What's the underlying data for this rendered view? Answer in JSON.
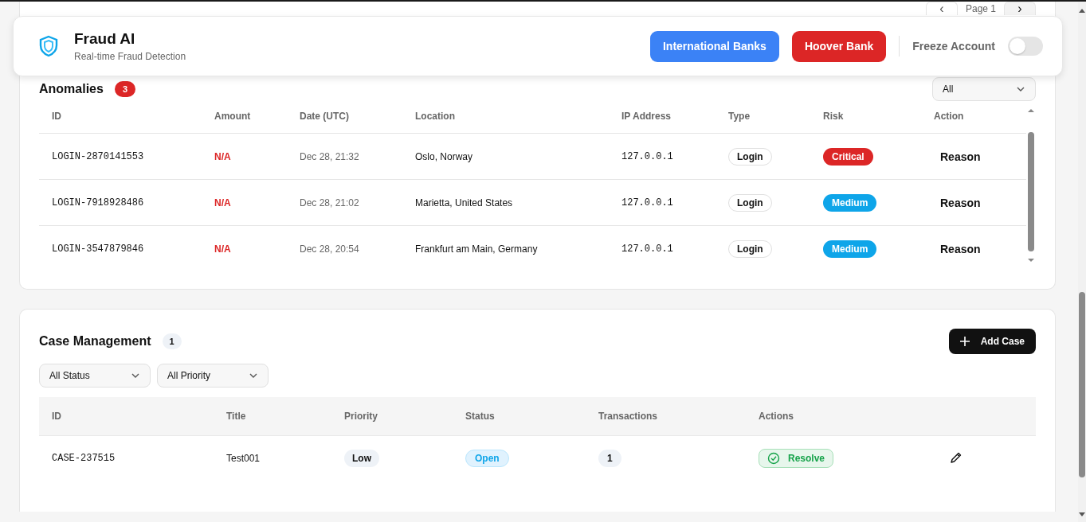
{
  "pager": {
    "prev": "‹",
    "label": "Page 1",
    "next": "›"
  },
  "header": {
    "title": "Fraud AI",
    "subtitle": "Real-time Fraud Detection",
    "buttons": [
      {
        "label": "International Banks",
        "color": "#3b82f6"
      },
      {
        "label": "Hoover Bank",
        "color": "#dc2626"
      }
    ],
    "freeze": {
      "label": "Freeze Account",
      "on": false
    }
  },
  "anomalies": {
    "title": "Anomalies",
    "count": "3",
    "filter": "All",
    "columns": [
      "ID",
      "Amount",
      "Date (UTC)",
      "Location",
      "IP Address",
      "Type",
      "Risk",
      "Action"
    ],
    "rows": [
      {
        "id": "LOGIN-2870141553",
        "amount": "N/A",
        "date": "Dec 28, 21:32",
        "location": "Oslo, Norway",
        "ip": "127.0.0.1",
        "type": "Login",
        "risk": {
          "label": "Critical",
          "color": "#dc2626"
        },
        "action": "Reason"
      },
      {
        "id": "LOGIN-7918928486",
        "amount": "N/A",
        "date": "Dec 28, 21:02",
        "location": "Marietta, United States",
        "ip": "127.0.0.1",
        "type": "Login",
        "risk": {
          "label": "Medium",
          "color": "#0ea5e9"
        },
        "action": "Reason"
      },
      {
        "id": "LOGIN-3547879846",
        "amount": "N/A",
        "date": "Dec 28, 20:54",
        "location": "Frankfurt am Main, Germany",
        "ip": "127.0.0.1",
        "type": "Login",
        "risk": {
          "label": "Medium",
          "color": "#0ea5e9"
        },
        "action": "Reason"
      }
    ]
  },
  "cases": {
    "title": "Case Management",
    "count": "1",
    "add_button": "Add Case",
    "filters": [
      "All Status",
      "All Priority"
    ],
    "columns": [
      "ID",
      "Title",
      "Priority",
      "Status",
      "Transactions",
      "Actions"
    ],
    "rows": [
      {
        "id": "CASE-237515",
        "title": "Test001",
        "priority": "Low",
        "status": "Open",
        "transactions": "1",
        "action": "Resolve"
      }
    ]
  }
}
